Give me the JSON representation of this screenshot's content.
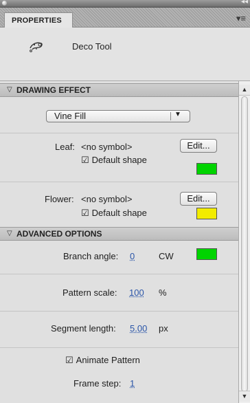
{
  "panel": {
    "tab_label": "PROPERTIES",
    "menu_icon": "panel-menu-icon"
  },
  "tool": {
    "name": "Deco Tool",
    "icon": "deco-tool-icon"
  },
  "drawing_effect": {
    "header": "DRAWING EFFECT",
    "effect_selected": "Vine Fill",
    "leaf": {
      "label": "Leaf:",
      "symbol": "<no symbol>",
      "edit_label": "Edit...",
      "default_shape_label": "Default shape",
      "default_shape_checked": true,
      "color": "#00d400"
    },
    "flower": {
      "label": "Flower:",
      "symbol": "<no symbol>",
      "edit_label": "Edit...",
      "default_shape_label": "Default shape",
      "default_shape_checked": true,
      "color": "#f2ec00"
    }
  },
  "advanced_options": {
    "header": "ADVANCED OPTIONS",
    "branch_angle": {
      "label": "Branch angle:",
      "value": "0",
      "unit": "CW",
      "color": "#00d400"
    },
    "pattern_scale": {
      "label": "Pattern scale:",
      "value": "100",
      "unit": "%"
    },
    "segment_length": {
      "label": "Segment length:",
      "value": "5.00",
      "unit": "px"
    },
    "animate_pattern": {
      "label": "Animate Pattern",
      "checked": true
    },
    "frame_step": {
      "label": "Frame step:",
      "value": "1"
    }
  },
  "glyphs": {
    "checkbox_checked": "☑",
    "triangle_open": "▽",
    "dropdown_arrow": "▼",
    "scroll_up": "▲",
    "scroll_down": "▼",
    "collapse": "◂◂",
    "menu": "▾≡"
  }
}
